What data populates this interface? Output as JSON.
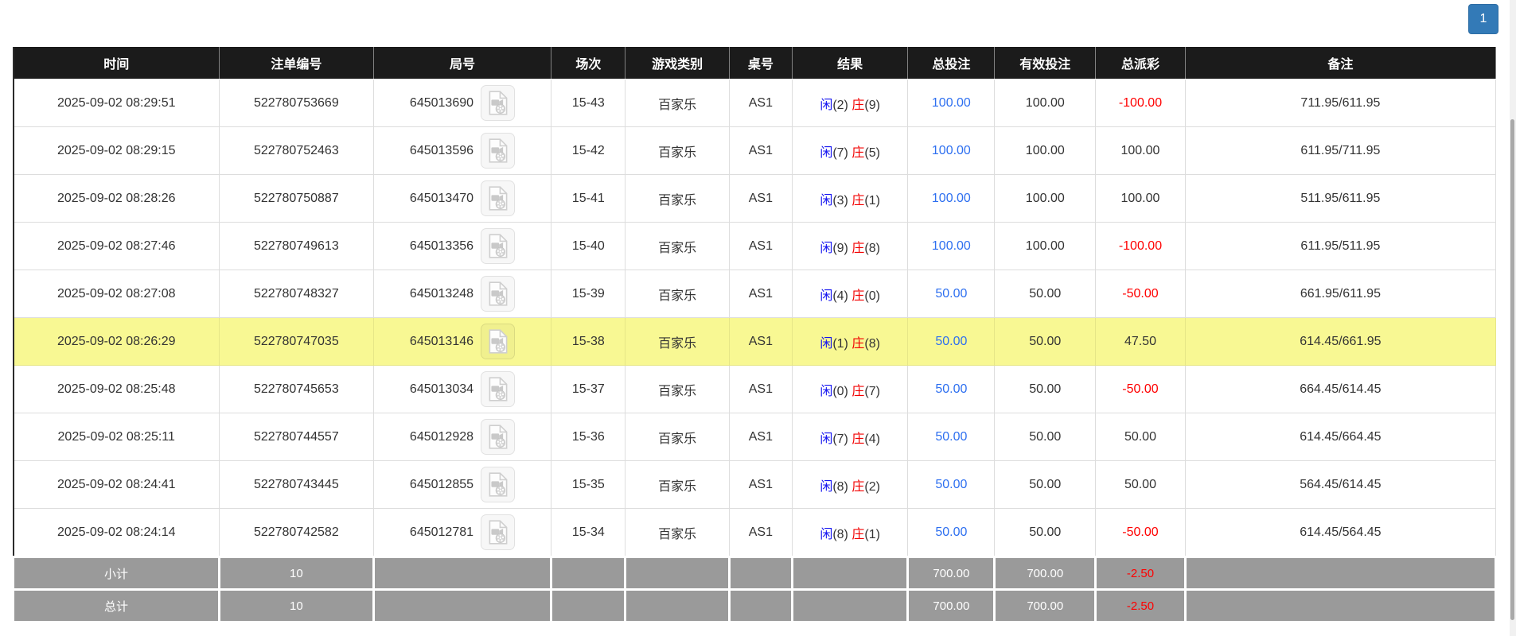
{
  "pagination": {
    "current_page": "1"
  },
  "colors": {
    "header_bg": "#1b1b1b",
    "accent_blue": "#337ab7",
    "highlight_row": "#f8f893",
    "player_blue": "#1414f0",
    "banker_red": "#f20000",
    "amount_blue": "#2d6ff0",
    "loss_red": "#ff0000",
    "summary_bg": "#9a9a9a"
  },
  "table": {
    "headers": [
      "时间",
      "注单编号",
      "局号",
      "场次",
      "游戏类别",
      "桌号",
      "结果",
      "总投注",
      "有效投注",
      "总派彩",
      "备注"
    ],
    "rows": [
      {
        "time": "2025-09-02 08:29:51",
        "bet_id": "522780753669",
        "round_no": "645013690",
        "session": "15-43",
        "game_type": "百家乐",
        "table_no": "AS1",
        "result": {
          "player": "闲",
          "player_score": "(2)",
          "banker": "庄",
          "banker_score": "(9)"
        },
        "total_bet": "100.00",
        "valid_bet": "100.00",
        "payout": "-100.00",
        "remark": "711.95/611.95",
        "highlighted": false
      },
      {
        "time": "2025-09-02 08:29:15",
        "bet_id": "522780752463",
        "round_no": "645013596",
        "session": "15-42",
        "game_type": "百家乐",
        "table_no": "AS1",
        "result": {
          "player": "闲",
          "player_score": "(7)",
          "banker": "庄",
          "banker_score": "(5)"
        },
        "total_bet": "100.00",
        "valid_bet": "100.00",
        "payout": "100.00",
        "remark": "611.95/711.95",
        "highlighted": false
      },
      {
        "time": "2025-09-02 08:28:26",
        "bet_id": "522780750887",
        "round_no": "645013470",
        "session": "15-41",
        "game_type": "百家乐",
        "table_no": "AS1",
        "result": {
          "player": "闲",
          "player_score": "(3)",
          "banker": "庄",
          "banker_score": "(1)"
        },
        "total_bet": "100.00",
        "valid_bet": "100.00",
        "payout": "100.00",
        "remark": "511.95/611.95",
        "highlighted": false
      },
      {
        "time": "2025-09-02 08:27:46",
        "bet_id": "522780749613",
        "round_no": "645013356",
        "session": "15-40",
        "game_type": "百家乐",
        "table_no": "AS1",
        "result": {
          "player": "闲",
          "player_score": "(9)",
          "banker": "庄",
          "banker_score": "(8)"
        },
        "total_bet": "100.00",
        "valid_bet": "100.00",
        "payout": "-100.00",
        "remark": "611.95/511.95",
        "highlighted": false
      },
      {
        "time": "2025-09-02 08:27:08",
        "bet_id": "522780748327",
        "round_no": "645013248",
        "session": "15-39",
        "game_type": "百家乐",
        "table_no": "AS1",
        "result": {
          "player": "闲",
          "player_score": "(4)",
          "banker": "庄",
          "banker_score": "(0)"
        },
        "total_bet": "50.00",
        "valid_bet": "50.00",
        "payout": "-50.00",
        "remark": "661.95/611.95",
        "highlighted": false
      },
      {
        "time": "2025-09-02 08:26:29",
        "bet_id": "522780747035",
        "round_no": "645013146",
        "session": "15-38",
        "game_type": "百家乐",
        "table_no": "AS1",
        "result": {
          "player": "闲",
          "player_score": "(1)",
          "banker": "庄",
          "banker_score": "(8)"
        },
        "total_bet": "50.00",
        "valid_bet": "50.00",
        "payout": "47.50",
        "remark": "614.45/661.95",
        "highlighted": true
      },
      {
        "time": "2025-09-02 08:25:48",
        "bet_id": "522780745653",
        "round_no": "645013034",
        "session": "15-37",
        "game_type": "百家乐",
        "table_no": "AS1",
        "result": {
          "player": "闲",
          "player_score": "(0)",
          "banker": "庄",
          "banker_score": "(7)"
        },
        "total_bet": "50.00",
        "valid_bet": "50.00",
        "payout": "-50.00",
        "remark": "664.45/614.45",
        "highlighted": false
      },
      {
        "time": "2025-09-02 08:25:11",
        "bet_id": "522780744557",
        "round_no": "645012928",
        "session": "15-36",
        "game_type": "百家乐",
        "table_no": "AS1",
        "result": {
          "player": "闲",
          "player_score": "(7)",
          "banker": "庄",
          "banker_score": "(4)"
        },
        "total_bet": "50.00",
        "valid_bet": "50.00",
        "payout": "50.00",
        "remark": "614.45/664.45",
        "highlighted": false
      },
      {
        "time": "2025-09-02 08:24:41",
        "bet_id": "522780743445",
        "round_no": "645012855",
        "session": "15-35",
        "game_type": "百家乐",
        "table_no": "AS1",
        "result": {
          "player": "闲",
          "player_score": "(8)",
          "banker": "庄",
          "banker_score": "(2)"
        },
        "total_bet": "50.00",
        "valid_bet": "50.00",
        "payout": "50.00",
        "remark": "564.45/614.45",
        "highlighted": false
      },
      {
        "time": "2025-09-02 08:24:14",
        "bet_id": "522780742582",
        "round_no": "645012781",
        "session": "15-34",
        "game_type": "百家乐",
        "table_no": "AS1",
        "result": {
          "player": "闲",
          "player_score": "(8)",
          "banker": "庄",
          "banker_score": "(1)"
        },
        "total_bet": "50.00",
        "valid_bet": "50.00",
        "payout": "-50.00",
        "remark": "614.45/564.45",
        "highlighted": false
      }
    ],
    "summary_rows": [
      {
        "label": "小计",
        "count": "10",
        "total_bet": "700.00",
        "valid_bet": "700.00",
        "payout": "-2.50",
        "remark": ""
      },
      {
        "label": "总计",
        "count": "10",
        "total_bet": "700.00",
        "valid_bet": "700.00",
        "payout": "-2.50",
        "remark": ""
      }
    ]
  }
}
